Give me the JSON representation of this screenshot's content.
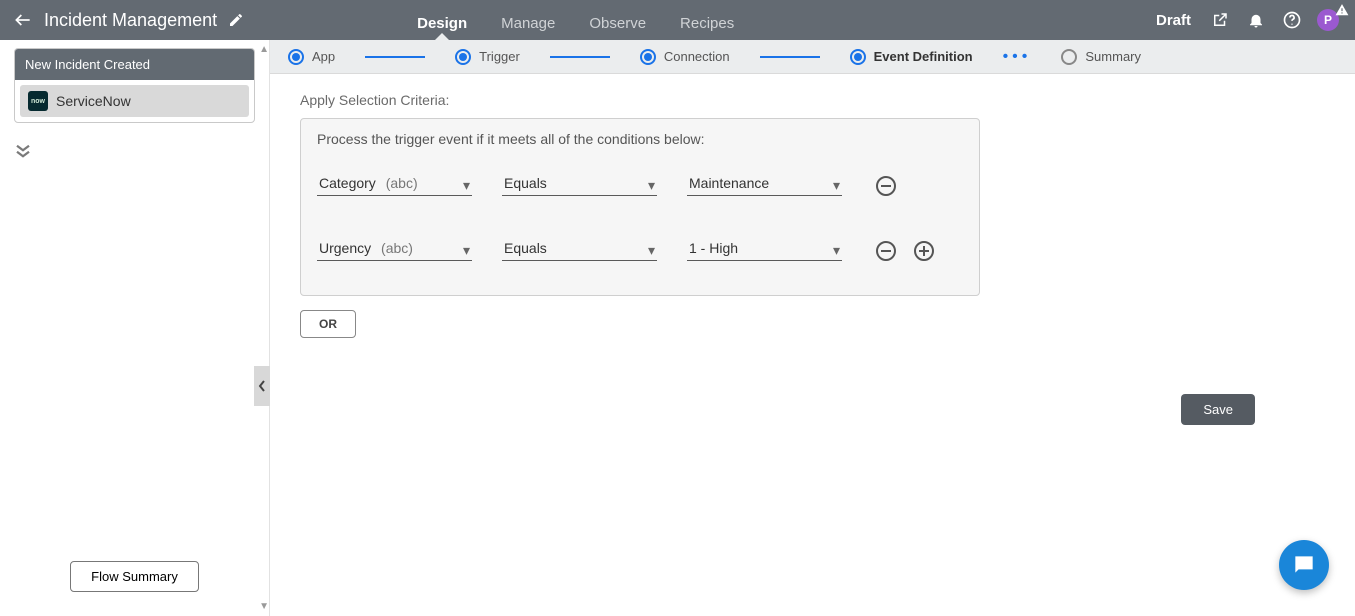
{
  "topbar": {
    "title": "Incident Management",
    "tabs": [
      "Design",
      "Manage",
      "Observe",
      "Recipes"
    ],
    "active_tab": 0,
    "status": "Draft",
    "avatar_initial": "P"
  },
  "sidebar": {
    "node_title": "New Incident Created",
    "node_app": "ServiceNow",
    "node_app_logo_text": "now",
    "flow_summary_label": "Flow Summary"
  },
  "stepper": {
    "steps": [
      "App",
      "Trigger",
      "Connection",
      "Event Definition",
      "Summary"
    ],
    "active_index": 3
  },
  "criteria": {
    "section_title": "Apply Selection Criteria:",
    "description": "Process the trigger event if it meets all of the conditions below:",
    "rows": [
      {
        "field": "Category",
        "type_hint": "(abc)",
        "operator": "Equals",
        "value": "Maintenance",
        "show_add": false
      },
      {
        "field": "Urgency",
        "type_hint": "(abc)",
        "operator": "Equals",
        "value": "1 - High",
        "show_add": true
      }
    ],
    "or_label": "OR",
    "save_label": "Save"
  }
}
